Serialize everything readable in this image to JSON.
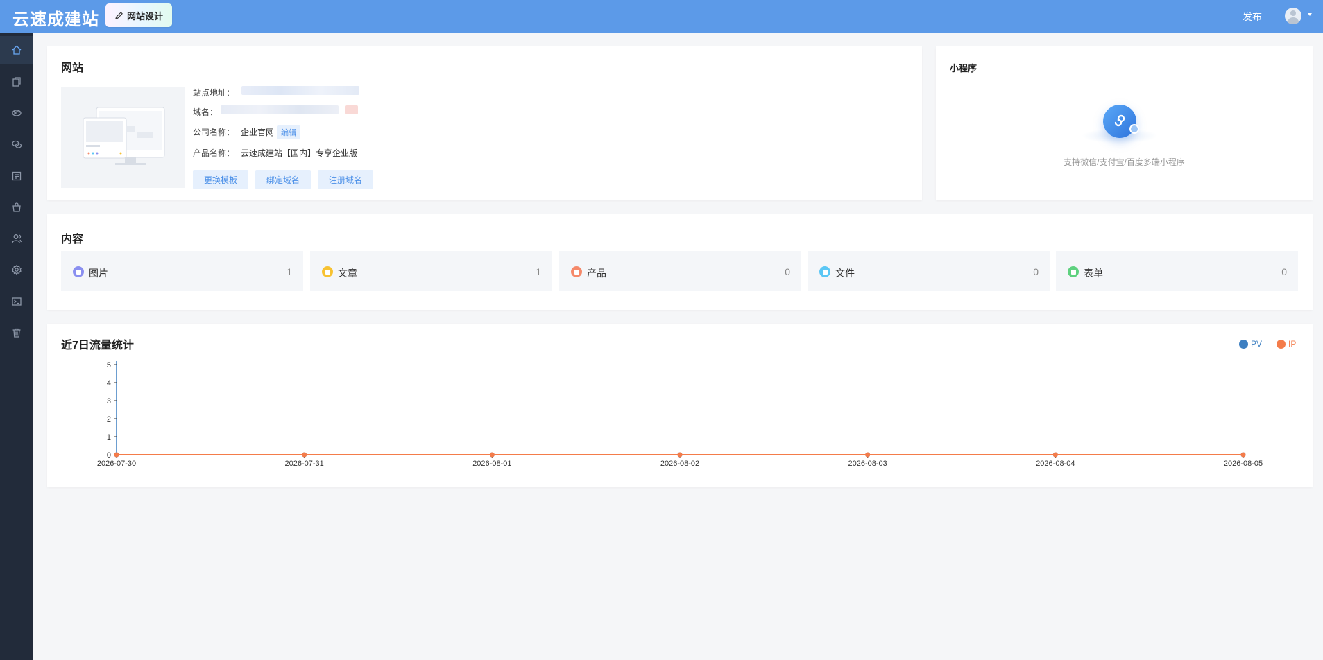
{
  "header": {
    "brand": "云速成建站",
    "design_button": "网站设计",
    "publish": "发布"
  },
  "sidebar": {
    "items": [
      {
        "icon": "home-icon",
        "active": true
      },
      {
        "icon": "pages-icon"
      },
      {
        "icon": "palette-icon"
      },
      {
        "icon": "wechat-icon"
      },
      {
        "icon": "article-list-icon"
      },
      {
        "icon": "shop-bag-icon"
      },
      {
        "icon": "members-icon"
      },
      {
        "icon": "gear-icon"
      },
      {
        "icon": "terminal-icon"
      },
      {
        "icon": "trash-icon"
      }
    ]
  },
  "website": {
    "title": "网站",
    "site_url_label": "站点地址：",
    "domain_label": "域名：",
    "company_label": "公司名称：",
    "company_value": "企业官网",
    "edit": "编辑",
    "product_label": "产品名称：",
    "product_value": "云速成建站【国内】专享企业版",
    "buttons": [
      "更换模板",
      "绑定域名",
      "注册域名"
    ]
  },
  "mini_program": {
    "title": "小程序",
    "desc": "支持微信/支付宝/百度多端小程序"
  },
  "content": {
    "title": "内容",
    "tiles": [
      {
        "label": "图片",
        "count": "1",
        "color": "#8a8ff0"
      },
      {
        "label": "文章",
        "count": "1",
        "color": "#f7c232"
      },
      {
        "label": "产品",
        "count": "0",
        "color": "#f5896a"
      },
      {
        "label": "文件",
        "count": "0",
        "color": "#5bc7f5"
      },
      {
        "label": "表单",
        "count": "0",
        "color": "#5ed17f"
      }
    ]
  },
  "traffic": {
    "title": "近7日流量统计",
    "legend_pv": "PV",
    "legend_ip": "IP"
  },
  "chart_data": {
    "type": "line",
    "title": "近7日流量统计",
    "x": [
      "2026-07-30",
      "2026-07-31",
      "2026-08-01",
      "2026-08-02",
      "2026-08-03",
      "2026-08-04",
      "2026-08-05"
    ],
    "series": [
      {
        "name": "PV",
        "values": [
          0,
          0,
          0,
          0,
          0,
          0,
          0
        ],
        "color": "#3d7fc1"
      },
      {
        "name": "IP",
        "values": [
          0,
          0,
          0,
          0,
          0,
          0,
          0
        ],
        "color": "#f47c4a"
      }
    ],
    "yticks": [
      "0",
      "1",
      "2",
      "3",
      "4",
      "5"
    ],
    "ylim": [
      0,
      5
    ],
    "grid": false,
    "legend": "top-right"
  }
}
